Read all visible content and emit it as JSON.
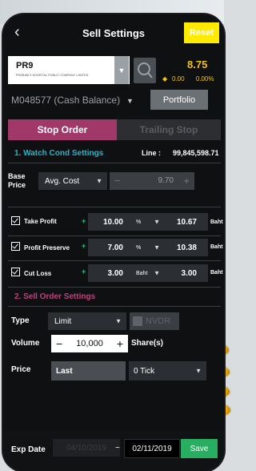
{
  "header": {
    "back_icon": "chevron-left-icon",
    "title": "Sell Settings",
    "reset_label": "Reset"
  },
  "symbol": {
    "name": "PR9",
    "company": "PRARAM 9 HOSPITAL PUBLIC COMPANY LIMITED",
    "price": "8.75",
    "change": "0.00",
    "change_pct": "0.00%"
  },
  "account": {
    "label": "M048577 (Cash Balance)",
    "portfolio_label": "Portfolio"
  },
  "tabs": {
    "active": "Stop Order",
    "inactive": "Trailing Stop"
  },
  "watch": {
    "section_title": "1. Watch Cond Settings",
    "line_label": "Line :",
    "line_value": "99,845,598.71",
    "base_price_label": "Base\nPrice",
    "base_price_mode": "Avg. Cost",
    "base_price_value": "9.70",
    "rows": [
      {
        "label": "Take Profit",
        "value": "10.00",
        "unit": "%",
        "result": "10.67",
        "currency": "Baht"
      },
      {
        "label": "Profit Preserve",
        "value": "7.00",
        "unit": "%",
        "result": "10.38",
        "currency": "Baht"
      },
      {
        "label": "Cut Loss",
        "value": "3.00",
        "unit": "Baht",
        "result": "3.00",
        "currency": "Baht"
      }
    ]
  },
  "order": {
    "section_title": "2. Sell Order Settings",
    "type_label": "Type",
    "type_value": "Limit",
    "nvdr_label": "NVDR",
    "volume_label": "Volume",
    "volume_value": "10,000",
    "volume_unit": "Share(s)",
    "price_label": "Price",
    "price_value": "Last",
    "tick_value": "0 Tick"
  },
  "expiry": {
    "label": "Exp Date",
    "from": "04/10/2019",
    "sep": "~",
    "to": "02/11/2019",
    "save_label": "Save"
  },
  "colors": {
    "accent_yellow": "#ffea00",
    "tab_active": "#a0396a",
    "section1": "#27b3c7",
    "section2": "#b8447a",
    "save": "#27ae60"
  }
}
